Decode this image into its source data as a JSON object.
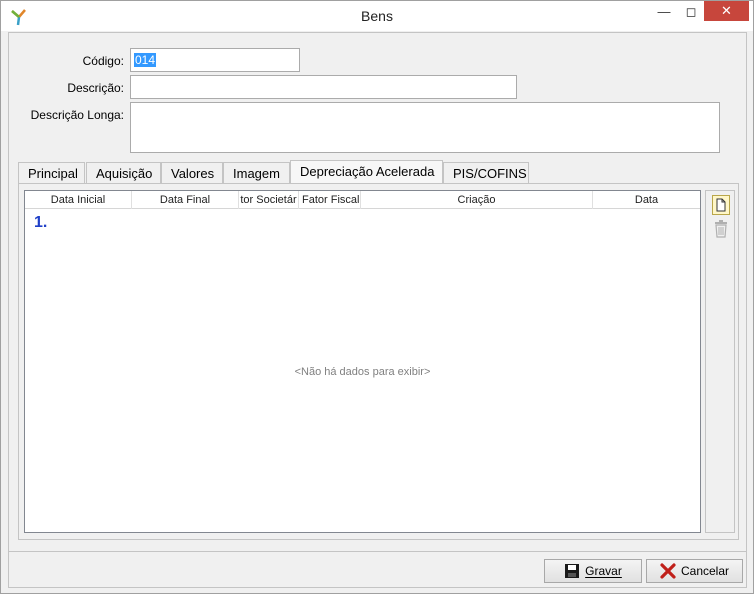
{
  "window": {
    "title": "Bens"
  },
  "form": {
    "codigo_label": "Código:",
    "codigo_value": "014",
    "descricao_label": "Descrição:",
    "descricao_value": "",
    "descricao_longa_label": "Descrição Longa:",
    "descricao_longa_value": ""
  },
  "tabs": [
    {
      "label": "Principal"
    },
    {
      "label": "Aquisição"
    },
    {
      "label": "Valores"
    },
    {
      "label": "Imagem"
    },
    {
      "label": "Depreciação Acelerada"
    },
    {
      "label": "PIS/COFINS"
    }
  ],
  "active_tab": "Depreciação Acelerada",
  "grid": {
    "columns": [
      {
        "label": "Data Inicial"
      },
      {
        "label": "Data Final"
      },
      {
        "label": "tor Societár"
      },
      {
        "label": "Fator Fiscal"
      },
      {
        "label": "Criação"
      },
      {
        "label": "Data"
      }
    ],
    "row_number": "1.",
    "empty_text": "<Não há dados para exibir>"
  },
  "toolbar": {
    "new_icon": "new-document-icon",
    "delete_icon": "trash-icon"
  },
  "buttons": {
    "save_label": "Gravar",
    "cancel_label": "Cancelar"
  },
  "colors": {
    "close_button": "#c7463c",
    "selection": "#3399ff",
    "row_number": "#2040c8"
  }
}
